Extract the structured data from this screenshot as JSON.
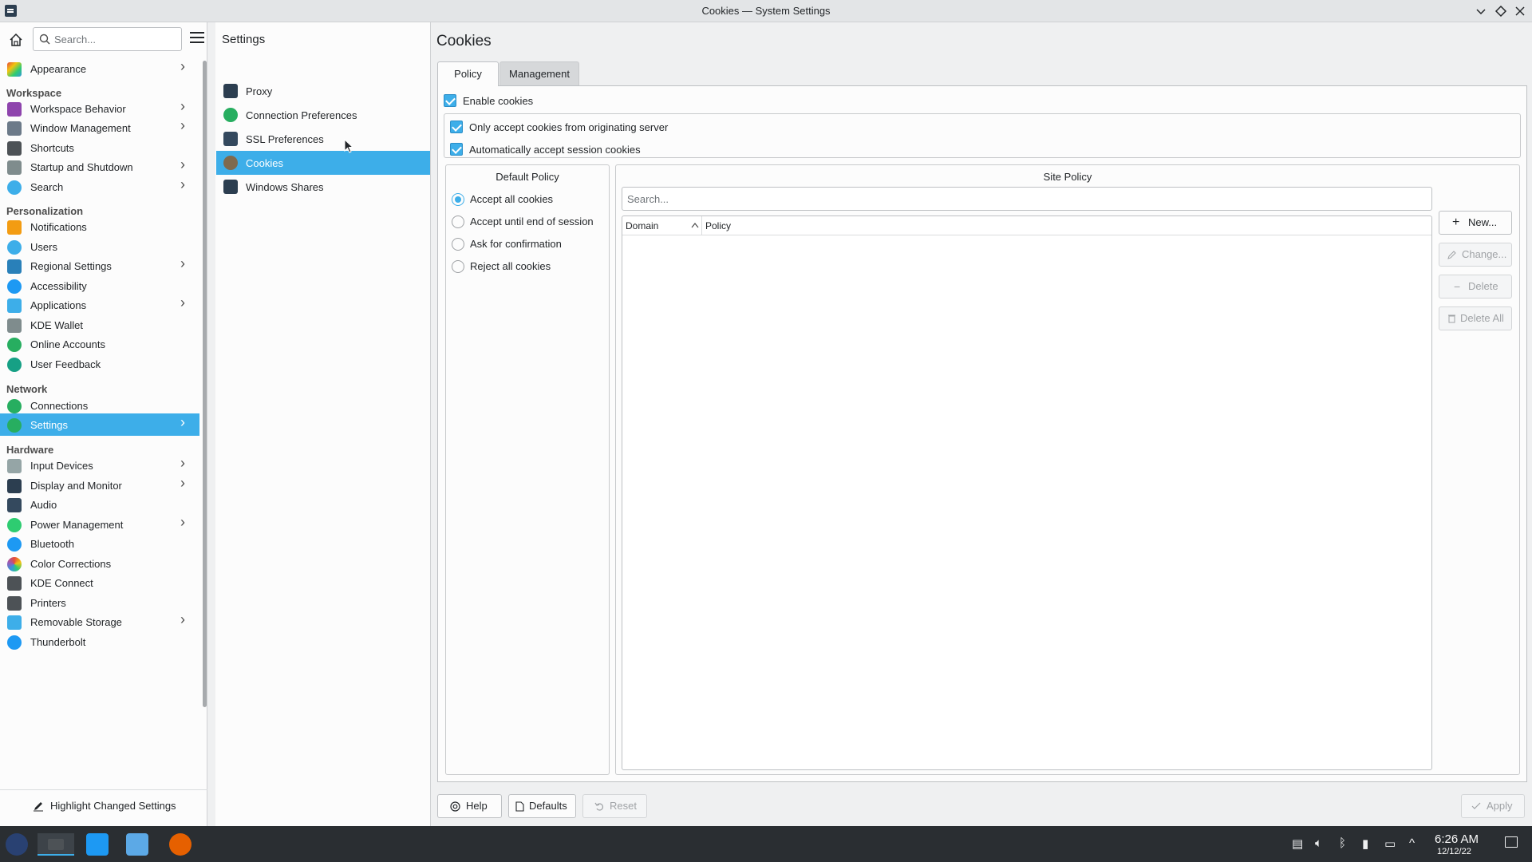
{
  "window": {
    "title": "Cookies — System Settings",
    "controls": [
      "minimize",
      "maximize",
      "close"
    ]
  },
  "sidebar": {
    "search_placeholder": "Search...",
    "items": [
      {
        "label": "Appearance",
        "icon": "appearance-icon",
        "chevron": true
      },
      {
        "header": "Workspace"
      },
      {
        "label": "Workspace Behavior",
        "icon": "workspace-behavior-icon",
        "chevron": true
      },
      {
        "label": "Window Management",
        "icon": "window-management-icon",
        "chevron": true
      },
      {
        "label": "Shortcuts",
        "icon": "keyboard-icon"
      },
      {
        "label": "Startup and Shutdown",
        "icon": "startup-icon",
        "chevron": true
      },
      {
        "label": "Search",
        "icon": "search-icon",
        "chevron": true
      },
      {
        "header": "Personalization"
      },
      {
        "label": "Notifications",
        "icon": "bell-icon"
      },
      {
        "label": "Users",
        "icon": "users-icon"
      },
      {
        "label": "Regional Settings",
        "icon": "regional-icon",
        "chevron": true
      },
      {
        "label": "Accessibility",
        "icon": "accessibility-icon"
      },
      {
        "label": "Applications",
        "icon": "applications-icon",
        "chevron": true
      },
      {
        "label": "KDE Wallet",
        "icon": "wallet-icon"
      },
      {
        "label": "Online Accounts",
        "icon": "online-accounts-icon"
      },
      {
        "label": "User Feedback",
        "icon": "feedback-icon"
      },
      {
        "header": "Network"
      },
      {
        "label": "Connections",
        "icon": "connections-icon"
      },
      {
        "label": "Settings",
        "icon": "network-settings-icon",
        "chevron": true,
        "active": true
      },
      {
        "header": "Hardware"
      },
      {
        "label": "Input Devices",
        "icon": "mouse-icon",
        "chevron": true
      },
      {
        "label": "Display and Monitor",
        "icon": "monitor-icon",
        "chevron": true
      },
      {
        "label": "Audio",
        "icon": "audio-icon"
      },
      {
        "label": "Power Management",
        "icon": "power-icon",
        "chevron": true
      },
      {
        "label": "Bluetooth",
        "icon": "bluetooth-icon"
      },
      {
        "label": "Color Corrections",
        "icon": "color-icon"
      },
      {
        "label": "KDE Connect",
        "icon": "kde-connect-icon"
      },
      {
        "label": "Printers",
        "icon": "printer-icon"
      },
      {
        "label": "Removable Storage",
        "icon": "usb-icon",
        "chevron": true
      },
      {
        "label": "Thunderbolt",
        "icon": "thunderbolt-icon"
      }
    ],
    "footer_button": "Highlight Changed Settings"
  },
  "middle": {
    "title": "Settings",
    "items": [
      {
        "label": "Proxy",
        "icon": "proxy-icon"
      },
      {
        "label": "Connection Preferences",
        "icon": "globe-icon"
      },
      {
        "label": "SSL Preferences",
        "icon": "ssl-icon"
      },
      {
        "label": "Cookies",
        "icon": "cookie-icon",
        "active": true
      },
      {
        "label": "Windows Shares",
        "icon": "shares-icon"
      }
    ]
  },
  "content": {
    "title": "Cookies",
    "tabs": [
      {
        "label": "Policy",
        "active": true
      },
      {
        "label": "Management"
      }
    ],
    "enable_cookies": {
      "label": "Enable cookies",
      "checked": true
    },
    "only_originating": {
      "label": "Only accept cookies from originating server",
      "checked": true
    },
    "auto_session": {
      "label": "Automatically accept session cookies",
      "checked": true
    },
    "default_policy": {
      "title": "Default Policy",
      "options": [
        {
          "label": "Accept all cookies",
          "selected": true
        },
        {
          "label": "Accept until end of session"
        },
        {
          "label": "Ask for confirmation"
        },
        {
          "label": "Reject all cookies"
        }
      ]
    },
    "site_policy": {
      "title": "Site Policy",
      "search_placeholder": "Search...",
      "columns": [
        "Domain",
        "Policy"
      ],
      "rows": [],
      "buttons": [
        {
          "label": "New...",
          "enabled": true
        },
        {
          "label": "Change...",
          "enabled": false
        },
        {
          "label": "Delete",
          "enabled": false
        },
        {
          "label": "Delete All",
          "enabled": false
        }
      ]
    },
    "footer": {
      "help": "Help",
      "defaults": "Defaults",
      "reset": "Reset",
      "apply": "Apply"
    }
  },
  "taskbar": {
    "time": "6:26 AM",
    "date": "12/12/22"
  },
  "colors": {
    "accent": "#3daee9",
    "window_bg": "#eff0f1",
    "view_bg": "#fcfcfc",
    "taskbar_bg": "#2a2e32"
  }
}
